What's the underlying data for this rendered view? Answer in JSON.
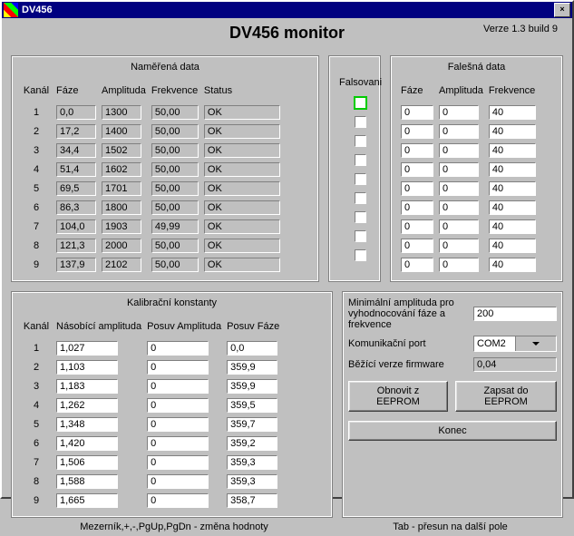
{
  "window": {
    "title": "DV456"
  },
  "version": "Verze 1.3  build 9",
  "app_title": "DV456 monitor",
  "headers": {
    "measured": "Naměřená data",
    "false": "Falešná data",
    "calib": "Kalibrační konstanty",
    "kanal": "Kanál",
    "faze": "Fáze",
    "amp": "Amplituda",
    "freq": "Frekvence",
    "status": "Status",
    "falsovani": "Falsovani",
    "mul_amp": "Násobící amplituda",
    "pos_amp": "Posuv Amplituda",
    "pos_phase": "Posuv Fáze"
  },
  "channels": [
    "1",
    "2",
    "3",
    "4",
    "5",
    "6",
    "7",
    "8",
    "9"
  ],
  "measured": [
    {
      "faze": "0,0",
      "amp": "1300",
      "freq": "50,00",
      "status": "OK"
    },
    {
      "faze": "17,2",
      "amp": "1400",
      "freq": "50,00",
      "status": "OK"
    },
    {
      "faze": "34,4",
      "amp": "1502",
      "freq": "50,00",
      "status": "OK"
    },
    {
      "faze": "51,4",
      "amp": "1602",
      "freq": "50,00",
      "status": "OK"
    },
    {
      "faze": "69,5",
      "amp": "1701",
      "freq": "50,00",
      "status": "OK"
    },
    {
      "faze": "86,3",
      "amp": "1800",
      "freq": "50,00",
      "status": "OK"
    },
    {
      "faze": "104,0",
      "amp": "1903",
      "freq": "49,99",
      "status": "OK"
    },
    {
      "faze": "121,3",
      "amp": "2000",
      "freq": "50,00",
      "status": "OK"
    },
    {
      "faze": "137,9",
      "amp": "2102",
      "freq": "50,00",
      "status": "OK"
    }
  ],
  "falsovani_checked": [
    false,
    false,
    false,
    false,
    false,
    false,
    false,
    false,
    false
  ],
  "falsovani_focused_index": 0,
  "false_data": [
    {
      "faze": "0",
      "amp": "0",
      "freq": "40"
    },
    {
      "faze": "0",
      "amp": "0",
      "freq": "40"
    },
    {
      "faze": "0",
      "amp": "0",
      "freq": "40"
    },
    {
      "faze": "0",
      "amp": "0",
      "freq": "40"
    },
    {
      "faze": "0",
      "amp": "0",
      "freq": "40"
    },
    {
      "faze": "0",
      "amp": "0",
      "freq": "40"
    },
    {
      "faze": "0",
      "amp": "0",
      "freq": "40"
    },
    {
      "faze": "0",
      "amp": "0",
      "freq": "40"
    },
    {
      "faze": "0",
      "amp": "0",
      "freq": "40"
    }
  ],
  "calib": [
    {
      "mul": "1,027",
      "pos_amp": "0",
      "pos_phase": "0,0"
    },
    {
      "mul": "1,103",
      "pos_amp": "0",
      "pos_phase": "359,9"
    },
    {
      "mul": "1,183",
      "pos_amp": "0",
      "pos_phase": "359,9"
    },
    {
      "mul": "1,262",
      "pos_amp": "0",
      "pos_phase": "359,5"
    },
    {
      "mul": "1,348",
      "pos_amp": "0",
      "pos_phase": "359,7"
    },
    {
      "mul": "1,420",
      "pos_amp": "0",
      "pos_phase": "359,2"
    },
    {
      "mul": "1,506",
      "pos_amp": "0",
      "pos_phase": "359,3"
    },
    {
      "mul": "1,588",
      "pos_amp": "0",
      "pos_phase": "359,3"
    },
    {
      "mul": "1,665",
      "pos_amp": "0",
      "pos_phase": "358,7"
    }
  ],
  "right": {
    "min_amp_label": "Minimální amplituda pro vyhodnocování fáze a frekvence",
    "min_amp_value": "200",
    "port_label": "Komunikační port",
    "port_value": "COM2",
    "fw_label": "Běžící verze firmware",
    "fw_value": "0,04",
    "btn_restore": "Obnovit z EEPROM",
    "btn_save": "Zapsat do EEPROM",
    "btn_close": "Konec"
  },
  "hints": {
    "left": "Mezerník,+,-,PgUp,PgDn - změna hodnoty",
    "right": "Tab - přesun na další pole"
  }
}
